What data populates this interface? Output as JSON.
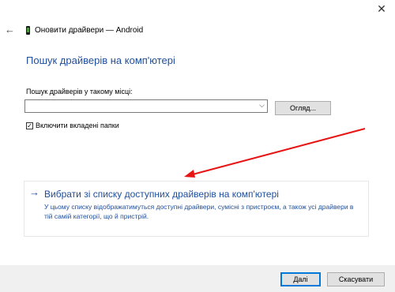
{
  "window": {
    "close_glyph": "✕",
    "back_glyph": "←",
    "title": "Оновити драйвери — Android"
  },
  "heading": "Пошук драйверів на комп'ютері",
  "search": {
    "label": "Пошук драйверів у такому місці:",
    "value": "",
    "browse_label": "Огляд..."
  },
  "include_subfolders": {
    "label": "Включити вкладені папки",
    "checked": true
  },
  "pick_option": {
    "title": "Вибрати зі списку доступних драйверів на комп'ютері",
    "description": "У цьому списку відображатимуться доступні драйвери, сумісні з пристроєм, а також усі драйвери в тій самій категорії, що й пристрій."
  },
  "footer": {
    "next_label": "Далі",
    "cancel_label": "Скасувати"
  },
  "colors": {
    "accent": "#1f4e9c",
    "annotation_arrow": "#e81414",
    "footer_bg": "#f0f0f0"
  },
  "icons": {
    "device": "android-phone-icon",
    "arrow": "arrow-right-icon"
  }
}
